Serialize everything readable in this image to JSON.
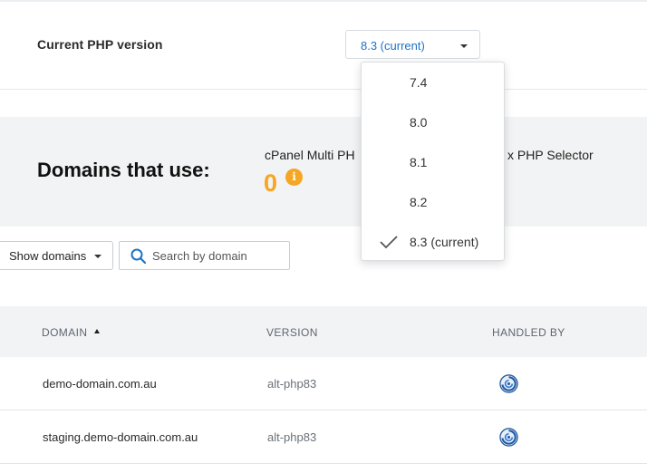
{
  "php_version": {
    "label": "Current PHP version",
    "selected": "8.3 (current)",
    "options": [
      "7.4",
      "8.0",
      "8.1",
      "8.2",
      "8.3 (current)"
    ]
  },
  "stats": {
    "domains_title": "Domains that use:",
    "multi_php_label": "cPanel Multi PH",
    "selector_label": "x PHP Selector",
    "multi_php_count": "0",
    "info_icon": "i"
  },
  "filters": {
    "show_domains_label": "Show domains",
    "search_placeholder": "Search by domain"
  },
  "table": {
    "headers": {
      "domain": "DOMAIN",
      "version": "VERSION",
      "handled_by": "HANDLED BY"
    },
    "rows": [
      {
        "domain": "demo-domain.com.au",
        "version": "alt-php83",
        "handled_by_icon": "cloudlinux-icon"
      },
      {
        "domain": "staging.demo-domain.com.au",
        "version": "alt-php83",
        "handled_by_icon": "cloudlinux-icon"
      }
    ]
  },
  "colors": {
    "accent_blue": "#1e73c8",
    "count_orange": "#f5a623",
    "band_gray": "#f2f3f4"
  }
}
